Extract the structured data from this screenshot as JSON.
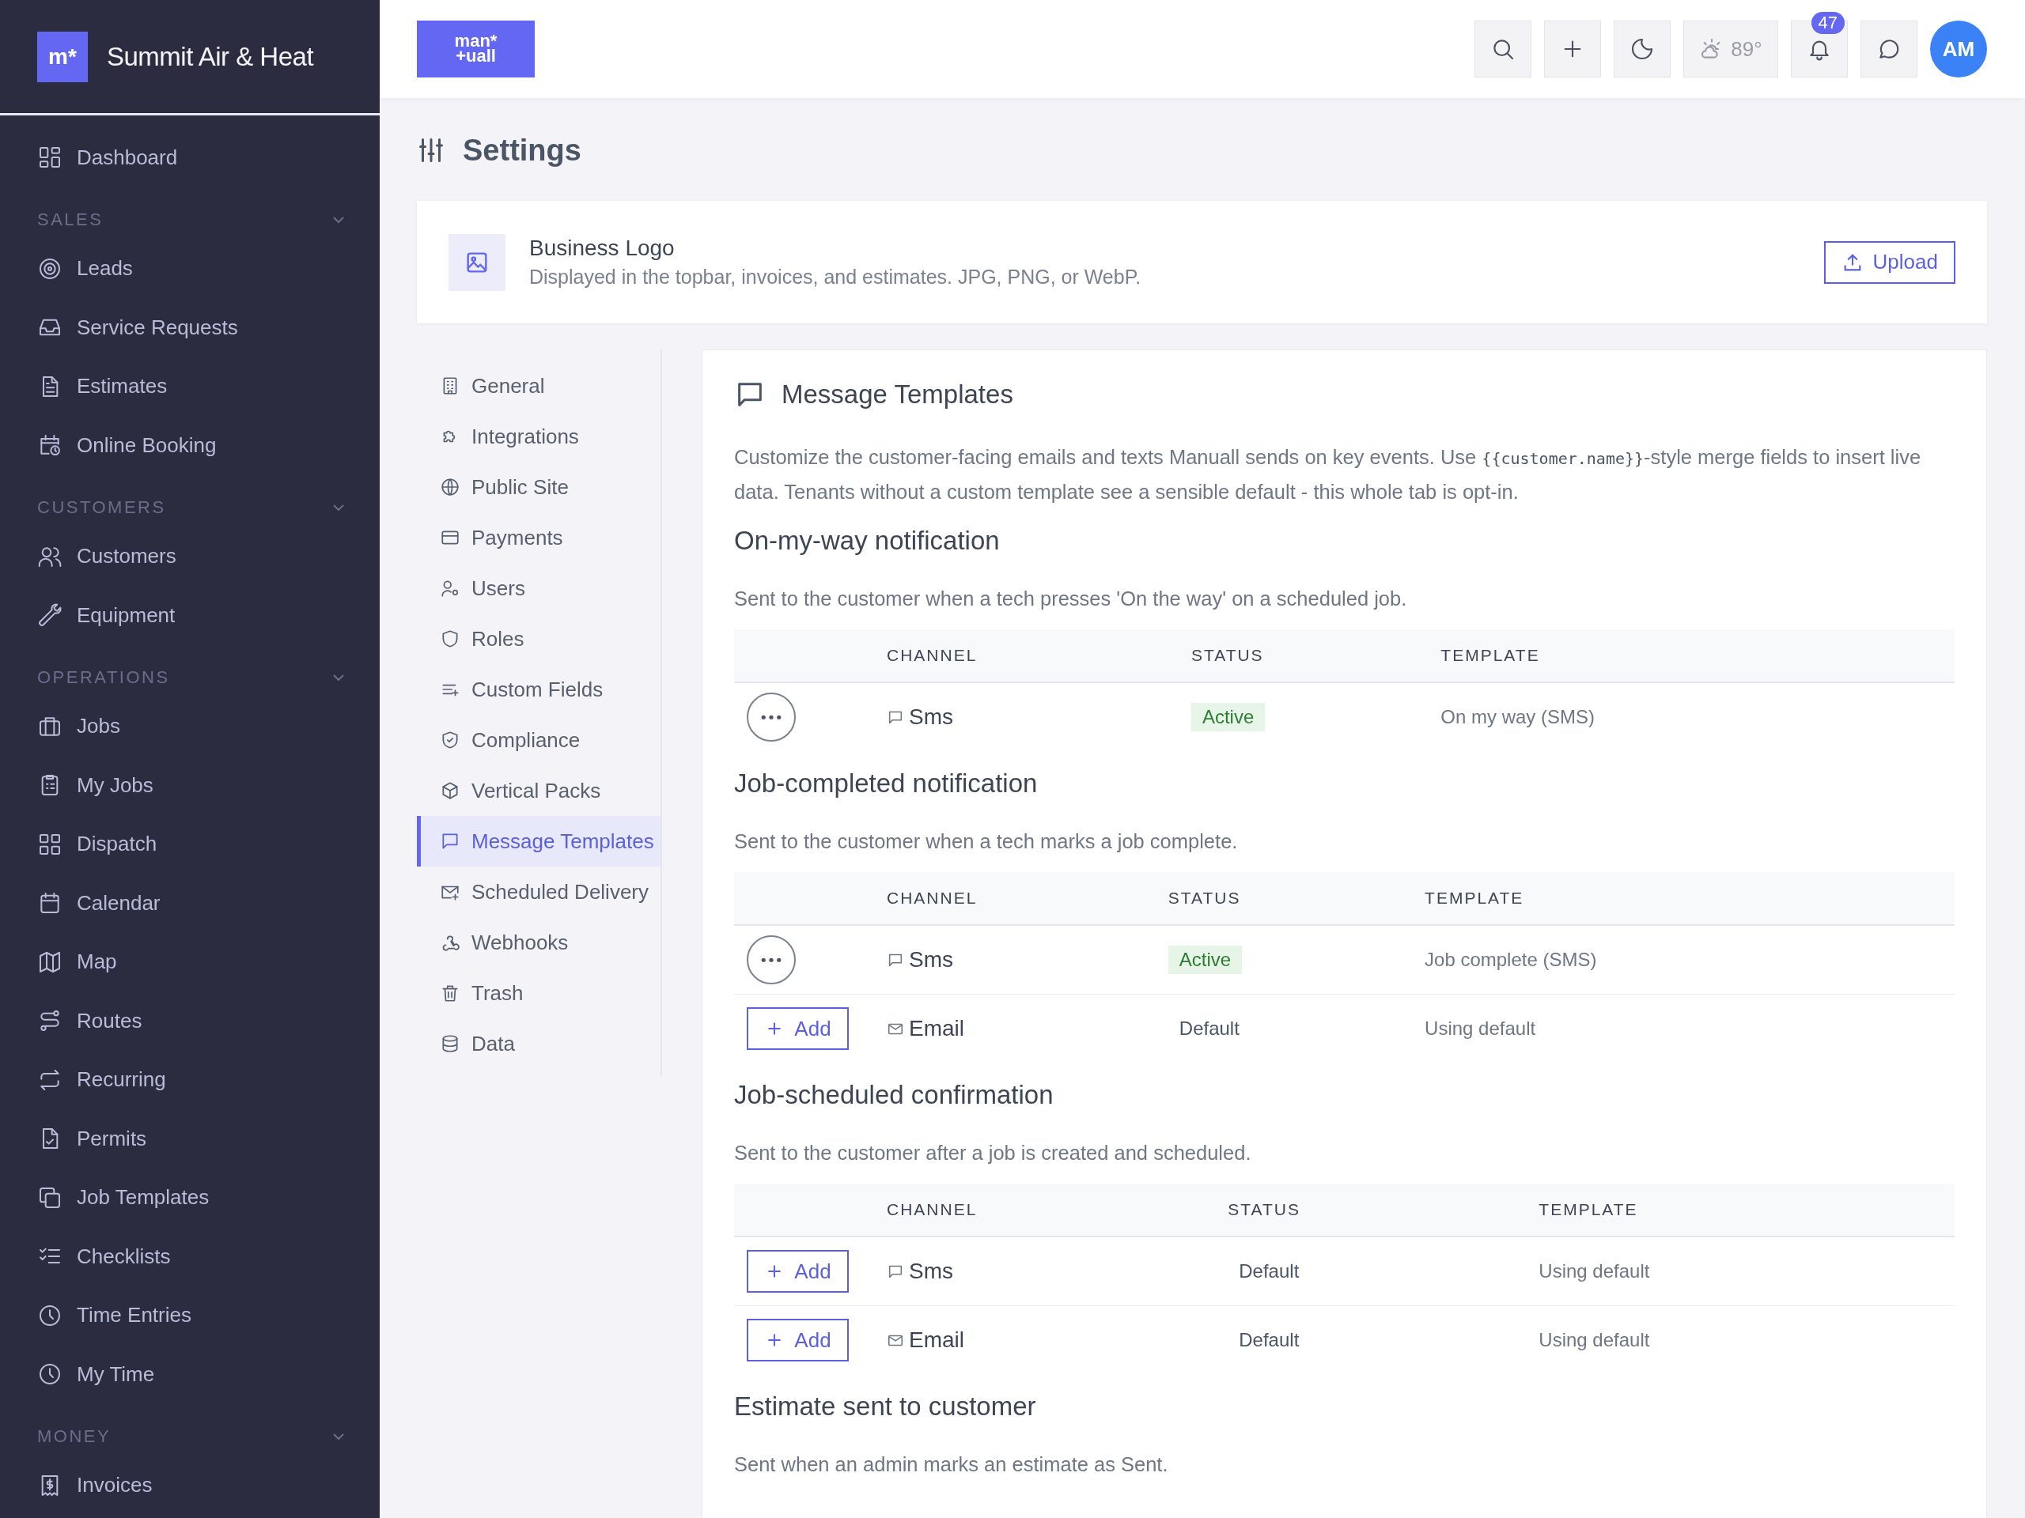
{
  "sidebar": {
    "brand": {
      "mark": "m*",
      "name": "Summit Air & Heat"
    },
    "groups": [
      {
        "items": [
          {
            "label": "Dashboard",
            "selected": false
          }
        ]
      },
      {
        "heading": "SALES",
        "expanded": true,
        "items": [
          {
            "label": "Leads",
            "selected": false
          },
          {
            "label": "Service Requests",
            "selected": false
          },
          {
            "label": "Estimates",
            "selected": false
          },
          {
            "label": "Online Booking",
            "selected": false
          }
        ]
      },
      {
        "heading": "CUSTOMERS",
        "expanded": true,
        "items": [
          {
            "label": "Customers",
            "selected": false
          },
          {
            "label": "Equipment",
            "selected": false
          }
        ]
      },
      {
        "heading": "OPERATIONS",
        "expanded": true,
        "items": [
          {
            "label": "Jobs",
            "selected": false
          },
          {
            "label": "My Jobs",
            "selected": false
          },
          {
            "label": "Dispatch",
            "selected": false
          },
          {
            "label": "Calendar",
            "selected": false
          },
          {
            "label": "Map",
            "selected": false
          },
          {
            "label": "Routes",
            "selected": false
          },
          {
            "label": "Recurring",
            "selected": false
          },
          {
            "label": "Permits",
            "selected": false
          },
          {
            "label": "Job Templates",
            "selected": false
          },
          {
            "label": "Checklists",
            "selected": false
          },
          {
            "label": "Time Entries",
            "selected": false
          },
          {
            "label": "My Time",
            "selected": false
          }
        ]
      },
      {
        "heading": "MONEY",
        "expanded": true,
        "items": [
          {
            "label": "Invoices",
            "selected": false
          }
        ]
      }
    ]
  },
  "topbar": {
    "logo": [
      "man*",
      "+uall"
    ],
    "weather": "89°",
    "notifications": "47",
    "avatar": "AM"
  },
  "page": {
    "title": "Settings"
  },
  "logo_card": {
    "title": "Business Logo",
    "description": "Displayed in the topbar, invoices, and estimates. JPG, PNG, or WebP.",
    "button": "Upload"
  },
  "settings_nav": [
    {
      "label": "General",
      "selected": false
    },
    {
      "label": "Integrations",
      "selected": false
    },
    {
      "label": "Public Site",
      "selected": false
    },
    {
      "label": "Payments",
      "selected": false
    },
    {
      "label": "Users",
      "selected": false
    },
    {
      "label": "Roles",
      "selected": false
    },
    {
      "label": "Custom Fields",
      "selected": false
    },
    {
      "label": "Compliance",
      "selected": false
    },
    {
      "label": "Vertical Packs",
      "selected": false
    },
    {
      "label": "Message Templates",
      "selected": true
    },
    {
      "label": "Scheduled Delivery",
      "selected": false
    },
    {
      "label": "Webhooks",
      "selected": false
    },
    {
      "label": "Trash",
      "selected": false
    },
    {
      "label": "Data",
      "selected": false
    }
  ],
  "panel": {
    "title": "Message Templates",
    "description": {
      "before": "Customize the customer-facing emails and texts Manuall sends on key events. Use ",
      "code": "{{customer.name}}",
      "after": "-style merge fields to insert live data. Tenants without a custom template see a sensible default - this whole tab is opt-in."
    },
    "sections": [
      {
        "title": "On-my-way notification",
        "description": "Sent to the customer when a tech presses 'On the way' on a scheduled job.",
        "table": {
          "columns": [
            "CHANNEL",
            "STATUS",
            "TEMPLATE"
          ],
          "rows": [
            {
              "action": {
                "kind": "menu"
              },
              "channel": {
                "kind": "sms",
                "label": "Sms"
              },
              "status": {
                "kind": "active",
                "label": "Active"
              },
              "template": "On my way (SMS)"
            }
          ]
        }
      },
      {
        "title": "Job-completed notification",
        "description": "Sent to the customer when a tech marks a job complete.",
        "table": {
          "columns": [
            "CHANNEL",
            "STATUS",
            "TEMPLATE"
          ],
          "rows": [
            {
              "action": {
                "kind": "menu"
              },
              "channel": {
                "kind": "sms",
                "label": "Sms"
              },
              "status": {
                "kind": "active",
                "label": "Active"
              },
              "template": "Job complete (SMS)"
            },
            {
              "action": {
                "kind": "add",
                "label": "Add"
              },
              "channel": {
                "kind": "email",
                "label": "Email"
              },
              "status": {
                "kind": "default",
                "label": "Default"
              },
              "template": "Using default"
            }
          ]
        }
      },
      {
        "title": "Job-scheduled confirmation",
        "description": "Sent to the customer after a job is created and scheduled.",
        "table": {
          "columns": [
            "CHANNEL",
            "STATUS",
            "TEMPLATE"
          ],
          "rows": [
            {
              "action": {
                "kind": "add",
                "label": "Add"
              },
              "channel": {
                "kind": "sms",
                "label": "Sms"
              },
              "status": {
                "kind": "default",
                "label": "Default"
              },
              "template": "Using default"
            },
            {
              "action": {
                "kind": "add",
                "label": "Add"
              },
              "channel": {
                "kind": "email",
                "label": "Email"
              },
              "status": {
                "kind": "default",
                "label": "Default"
              },
              "template": "Using default"
            }
          ]
        }
      },
      {
        "title": "Estimate sent to customer",
        "description": "Sent when an admin marks an estimate as Sent."
      }
    ]
  }
}
